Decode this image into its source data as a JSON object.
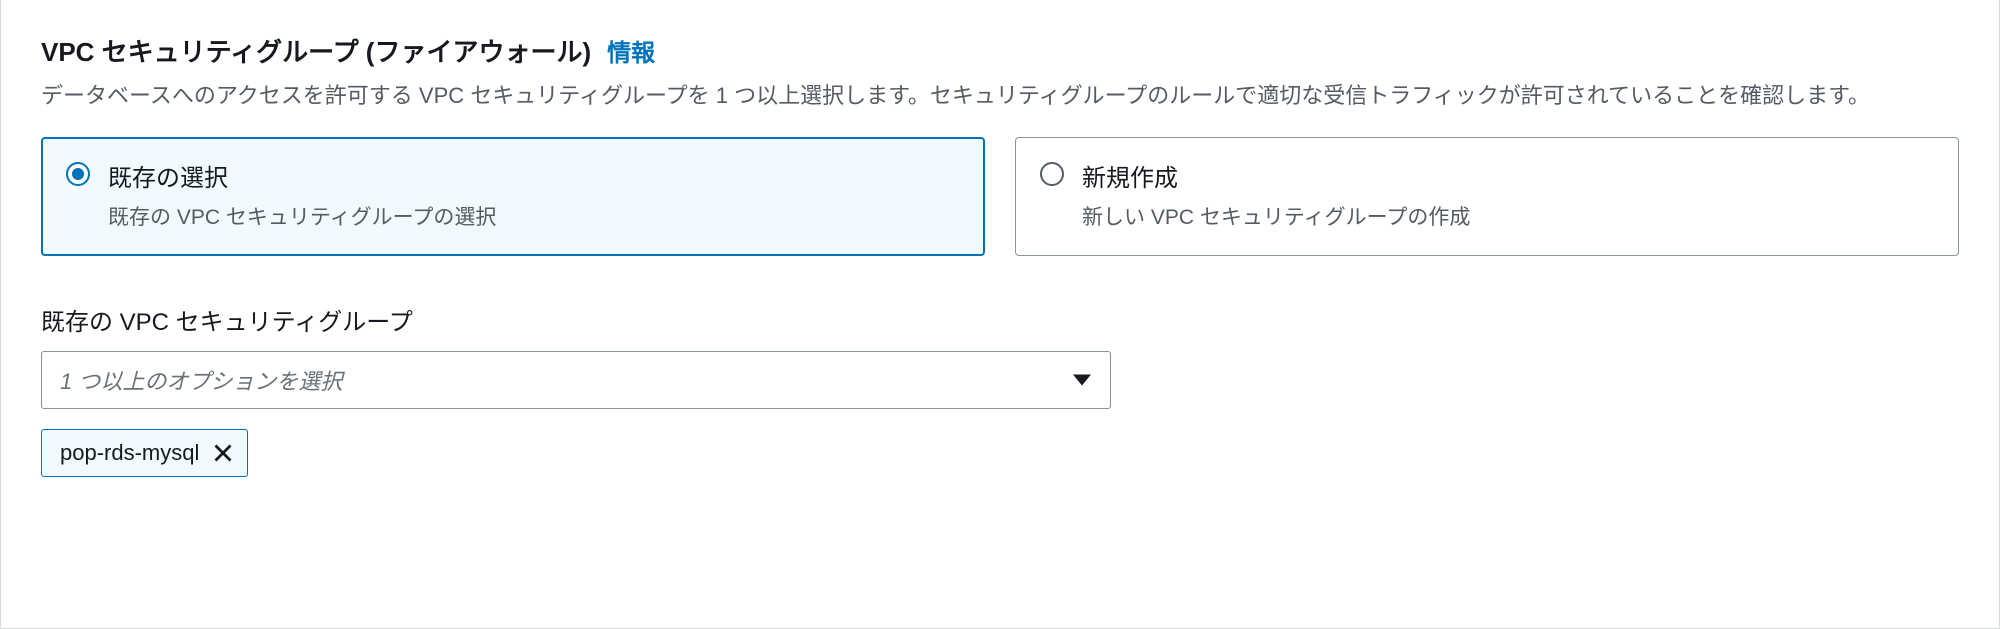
{
  "section": {
    "title": "VPC セキュリティグループ (ファイアウォール)",
    "info_link": "情報",
    "description": "データベースへのアクセスを許可する VPC セキュリティグループを 1 つ以上選択します。セキュリティグループのルールで適切な受信トラフィックが許可されていることを確認します。"
  },
  "options": {
    "existing": {
      "title": "既存の選択",
      "desc": "既存の VPC セキュリティグループの選択"
    },
    "create": {
      "title": "新規作成",
      "desc": "新しい VPC セキュリティグループの作成"
    }
  },
  "existing_field": {
    "label": "既存の VPC セキュリティグループ",
    "placeholder": "1 つ以上のオプションを選択",
    "selected_tags": [
      "pop-rds-mysql"
    ]
  }
}
